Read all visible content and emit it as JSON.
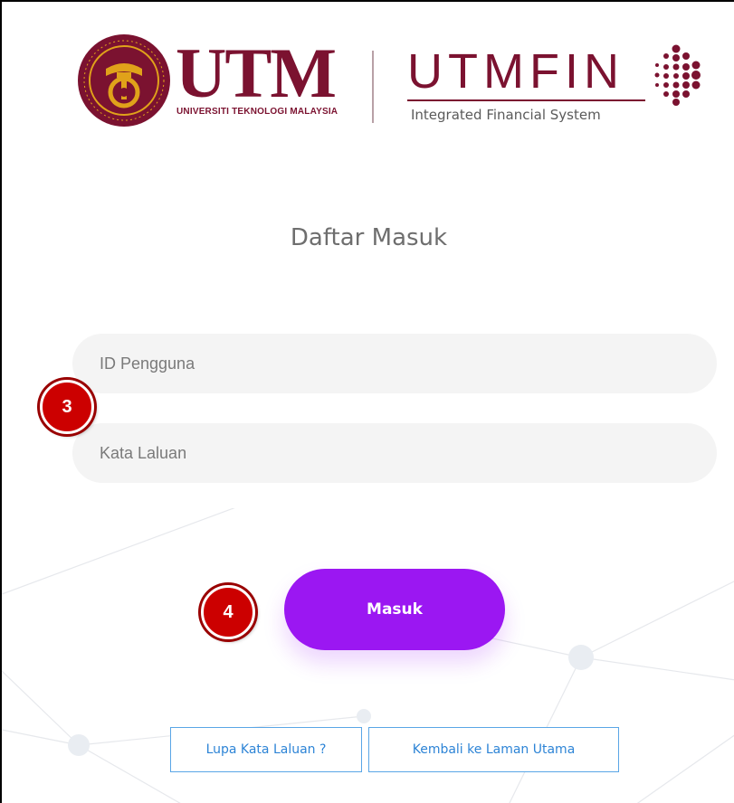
{
  "header": {
    "utm_logo_text": "UTM",
    "utm_logo_subtitle": "UNIVERSITI TEKNOLOGI MALAYSIA",
    "utmfin_logo_text": "UTMFIN",
    "utmfin_logo_subtitle": "Integrated Financial System"
  },
  "login": {
    "title": "Daftar Masuk",
    "username_placeholder": "ID Pengguna",
    "username_value": "",
    "password_placeholder": "Kata Laluan",
    "password_value": "",
    "submit_label": "Masuk"
  },
  "links": {
    "forgot_password": "Lupa Kata Laluan ?",
    "back_home": "Kembali ke Laman Utama"
  },
  "annotations": {
    "step_fields": "3",
    "step_submit": "4"
  },
  "colors": {
    "brand_maroon": "#7b1230",
    "button_purple": "#9b17f2",
    "link_blue": "#2d84d6",
    "badge_red": "#cc0000"
  }
}
